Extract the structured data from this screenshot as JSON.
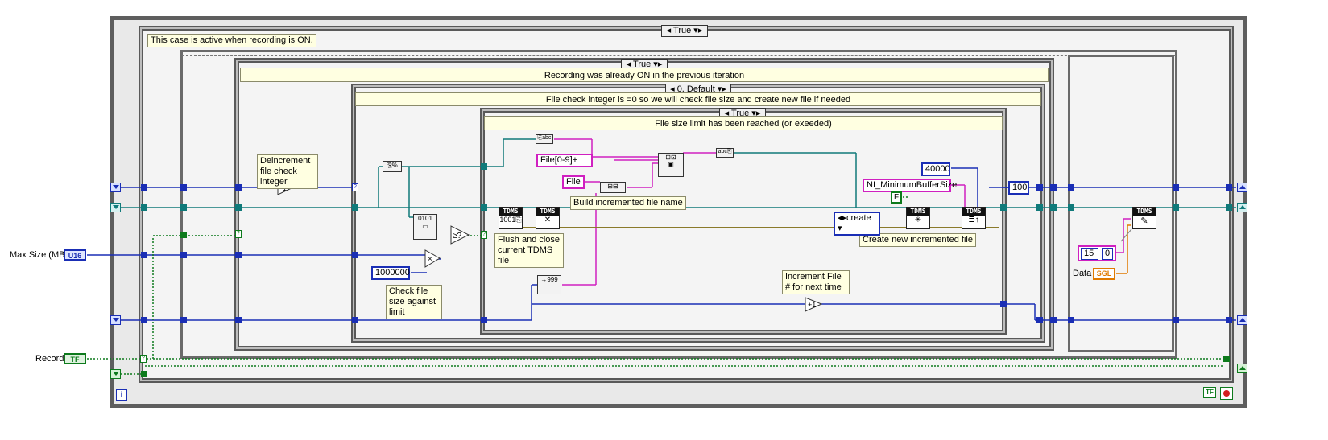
{
  "outer_case": {
    "selector": "True",
    "comment": "This case is active when recording is ON."
  },
  "recording_case": {
    "selector": "True",
    "banner": "Recording was already ON in the previous iteration"
  },
  "check_case": {
    "selector": "0, Default",
    "banner": "File check integer is =0 so we will check file size and create new file if needed"
  },
  "limit_case": {
    "selector": "True",
    "banner": "File size limit has been reached (or exeeded)"
  },
  "comments": {
    "decrement": "Deincrement file check integer",
    "check_size": "Check file size against limit",
    "flush_close": "Flush and close current TDMS file",
    "build_name": "Build incremented file name",
    "create_new": "Create new incremented file",
    "increment": "Increment File # for next time"
  },
  "controls": {
    "max_size": {
      "label": "Max Size (MB)",
      "type": "U16"
    },
    "record": {
      "label": "Record",
      "type": "TF"
    },
    "data": {
      "label": "Data",
      "type": "SGL"
    }
  },
  "constants": {
    "file_pattern": "File[0-9]+",
    "file": "File",
    "one_million": "1000000",
    "buffer_value": "40000",
    "buffer_property": "NI_MinimumBufferSize",
    "false_const": "F",
    "create_enum": "create",
    "hundred": "100",
    "fifteen": "15",
    "zero": "0"
  },
  "tdms_labels": {
    "tdms": "TDMS"
  },
  "terminals": {
    "true_term": "TF",
    "stop": "stop"
  },
  "colors": {
    "integer_wire": "#1a2eb5",
    "path_wire": "#107a7a",
    "string_wire": "#d020c0",
    "boolean_wire": "#0d7a1c",
    "float_wire": "#e07a00",
    "comment_bg": "#ffffe1"
  }
}
